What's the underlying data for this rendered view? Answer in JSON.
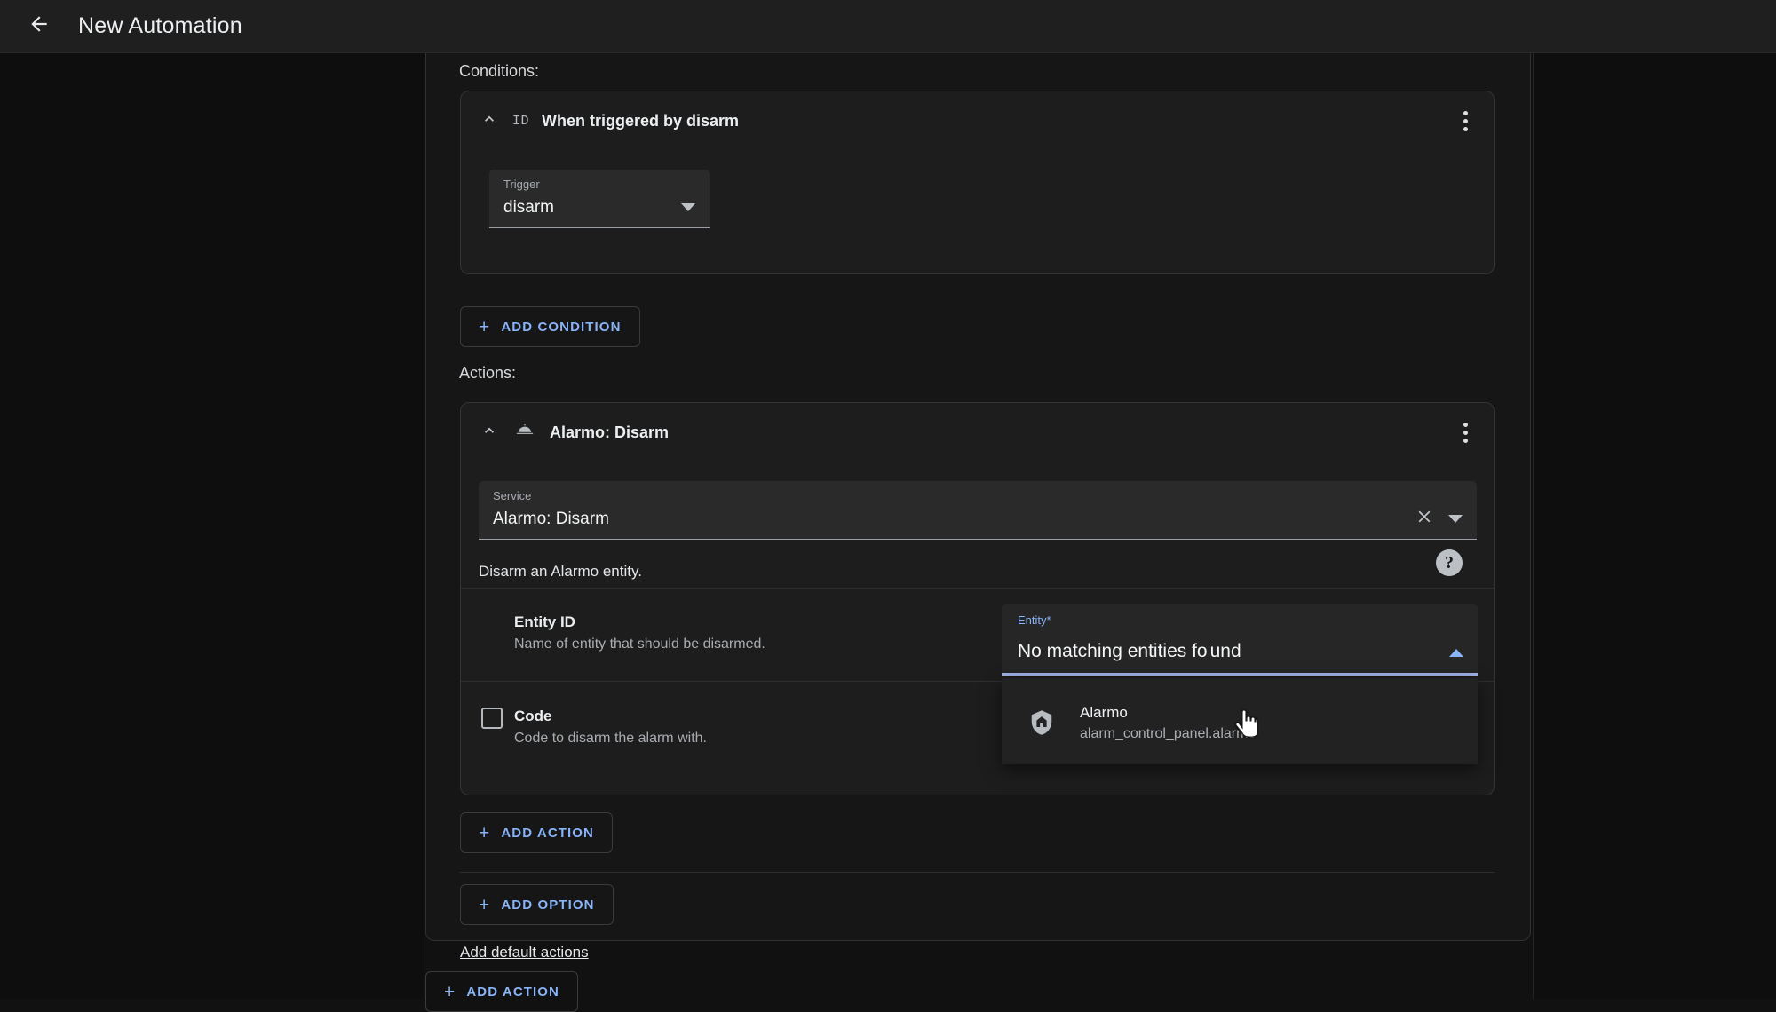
{
  "topbar": {
    "back_icon": "arrow-left-icon",
    "title": "New Automation"
  },
  "sections": {
    "conditions_label": "Conditions:",
    "actions_label": "Actions:"
  },
  "condition_card": {
    "collapse_icon": "chevron-up-icon",
    "type_icon": "ID",
    "title": "When triggered by disarm",
    "menu_icon": "kebab-menu-icon",
    "trigger_field": {
      "label": "Trigger",
      "value": "disarm",
      "arrow_icon": "chevron-down-icon"
    }
  },
  "add_condition_button": {
    "plus": "+",
    "label": "ADD CONDITION"
  },
  "action_card": {
    "collapse_icon": "chevron-up-icon",
    "service_icon": "room-service-icon",
    "title": "Alarmo: Disarm",
    "menu_icon": "kebab-menu-icon",
    "service_field": {
      "label": "Service",
      "value": "Alarmo: Disarm",
      "clear_icon": "close-icon",
      "arrow_icon": "chevron-down-icon"
    },
    "description": "Disarm an Alarmo entity.",
    "help_icon": "?",
    "fields": [
      {
        "title": "Entity ID",
        "subtitle": "Name of entity that should be disarmed."
      },
      {
        "title": "Code",
        "subtitle": "Code to disarm the alarm with.",
        "checkbox_checked": false
      }
    ],
    "entity_combobox": {
      "label": "Entity*",
      "value_before_caret": "No matching entities fo",
      "value_after_caret": "und",
      "arrow_icon": "chevron-up-icon",
      "options": [
        {
          "icon": "shield-home-icon",
          "primary": "Alarmo",
          "secondary": "alarm_control_panel.alarmo"
        }
      ]
    }
  },
  "add_action_button_inner": {
    "plus": "+",
    "label": "ADD ACTION"
  },
  "add_option_button": {
    "plus": "+",
    "label": "ADD OPTION"
  },
  "add_default_actions_link": "Add default actions",
  "add_action_button_outer": {
    "plus": "+",
    "label": "ADD ACTION"
  },
  "colors": {
    "accent": "#8ab4f8",
    "page_bg": "#111111",
    "card_bg": "#161616",
    "block_bg": "#1d1d1d",
    "field_bg": "#2a2a2a",
    "topbar_bg": "#1f1f1f",
    "text_primary": "#eceff1",
    "text_secondary": "#a9adb2"
  },
  "cursor": {
    "icon": "pointer-hand-cursor"
  }
}
